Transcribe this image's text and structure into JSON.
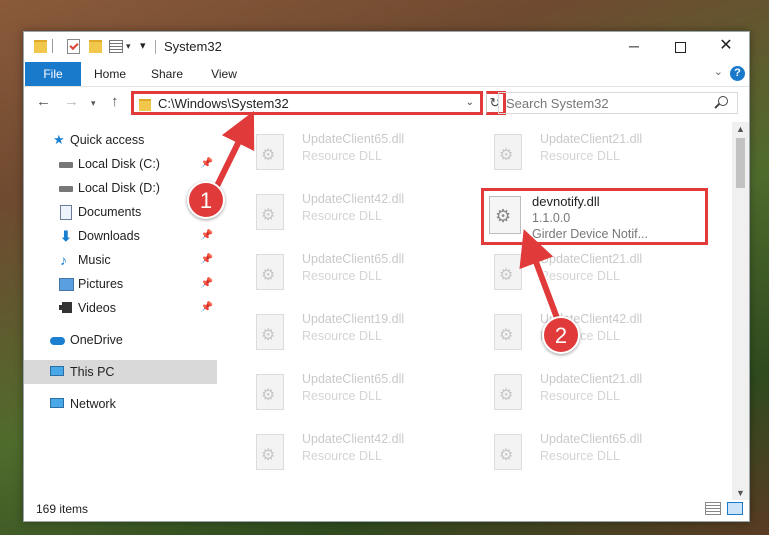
{
  "window": {
    "title": "System32"
  },
  "ribbon": {
    "tabs": [
      "File",
      "Home",
      "Share",
      "View"
    ]
  },
  "nav": {
    "address": "C:\\Windows\\System32",
    "search_placeholder": "Search System32"
  },
  "sidebar": {
    "items": [
      {
        "label": "Quick access",
        "icon": "star-icon",
        "pinned": false
      },
      {
        "label": "Local Disk (C:)",
        "icon": "drive-icon",
        "pinned": true
      },
      {
        "label": "Local Disk (D:)",
        "icon": "drive-icon",
        "pinned": false
      },
      {
        "label": "Documents",
        "icon": "documents-icon",
        "pinned": true
      },
      {
        "label": "Downloads",
        "icon": "downloads-icon",
        "pinned": true
      },
      {
        "label": "Music",
        "icon": "music-icon",
        "pinned": true
      },
      {
        "label": "Pictures",
        "icon": "pictures-icon",
        "pinned": true
      },
      {
        "label": "Videos",
        "icon": "videos-icon",
        "pinned": true
      },
      {
        "label": "OneDrive",
        "icon": "onedrive-icon",
        "pinned": false
      },
      {
        "label": "This PC",
        "icon": "this-pc-icon",
        "pinned": false,
        "selected": true
      },
      {
        "label": "Network",
        "icon": "network-icon",
        "pinned": false
      }
    ]
  },
  "files": [
    {
      "name": "UpdateClient65.dll",
      "type": "Resource DLL"
    },
    {
      "name": "UpdateClient21.dll",
      "type": "Resource DLL"
    },
    {
      "name": "UpdateClient42.dll",
      "type": "Resource DLL"
    },
    {
      "name": "UpdateClient65.dll",
      "type": "Resource DLL"
    },
    {
      "name": "UpdateClient21.dll",
      "type": "Resource DLL"
    },
    {
      "name": "UpdateClient19.dll",
      "type": "Resource DLL"
    },
    {
      "name": "UpdateClient42.dll",
      "type": "Resource DLL"
    },
    {
      "name": "UpdateClient65.dll",
      "type": "Resource DLL"
    },
    {
      "name": "UpdateClient21.dll",
      "type": "Resource DLL"
    },
    {
      "name": "UpdateClient42.dll",
      "type": "Resource DLL"
    },
    {
      "name": "UpdateClient65.dll",
      "type": "Resource DLL"
    }
  ],
  "highlighted_file": {
    "name": "devnotify.dll",
    "version": "1.1.0.0",
    "description": "Girder Device Notif..."
  },
  "status": {
    "item_count": "169 items"
  },
  "callouts": [
    "1",
    "2"
  ],
  "colors": {
    "accent": "#1979ca",
    "highlight": "#e03a3a"
  }
}
